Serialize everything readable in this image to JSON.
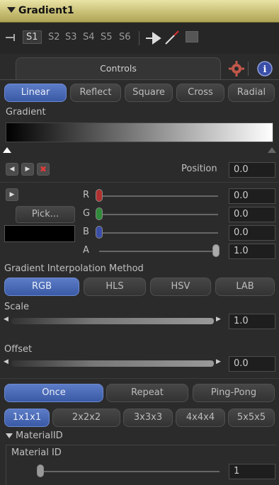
{
  "header": {
    "title": "Gradient1"
  },
  "toolbar": {
    "slots": [
      "S1",
      "S2",
      "S3",
      "S4",
      "S5",
      "S6"
    ],
    "active_slot": "S1"
  },
  "tabs": {
    "controls": "Controls"
  },
  "gradient_type": {
    "options": [
      "Linear",
      "Reflect",
      "Square",
      "Cross",
      "Radial"
    ],
    "selected": "Linear"
  },
  "gradient": {
    "label": "Gradient",
    "position_label": "Position",
    "position_value": "0.0"
  },
  "color": {
    "pick_label": "Pick...",
    "r_label": "R",
    "g_label": "G",
    "b_label": "B",
    "a_label": "A",
    "r_value": "0.0",
    "g_value": "0.0",
    "b_value": "0.0",
    "a_value": "1.0",
    "swatch_color": "#000000"
  },
  "interpolation": {
    "label": "Gradient Interpolation Method",
    "options": [
      "RGB",
      "HLS",
      "HSV",
      "LAB"
    ],
    "selected": "RGB"
  },
  "scale": {
    "label": "Scale",
    "value": "1.0"
  },
  "offset": {
    "label": "Offset",
    "value": "0.0"
  },
  "repeat": {
    "options": [
      "Once",
      "Repeat",
      "Ping-Pong"
    ],
    "selected": "Once"
  },
  "supersample": {
    "options": [
      "1x1x1",
      "2x2x2",
      "3x3x3",
      "4x4x4",
      "5x5x5"
    ],
    "selected": "1x1x1"
  },
  "material": {
    "section": "MaterialID",
    "label": "Material ID",
    "value": "1"
  },
  "colors": {
    "header_bg": "#c9c076",
    "accent_blue": "#3a5aa6",
    "knob_red": "#b03030",
    "knob_green": "#2f8a3a",
    "knob_blue": "#3a4ea8"
  }
}
